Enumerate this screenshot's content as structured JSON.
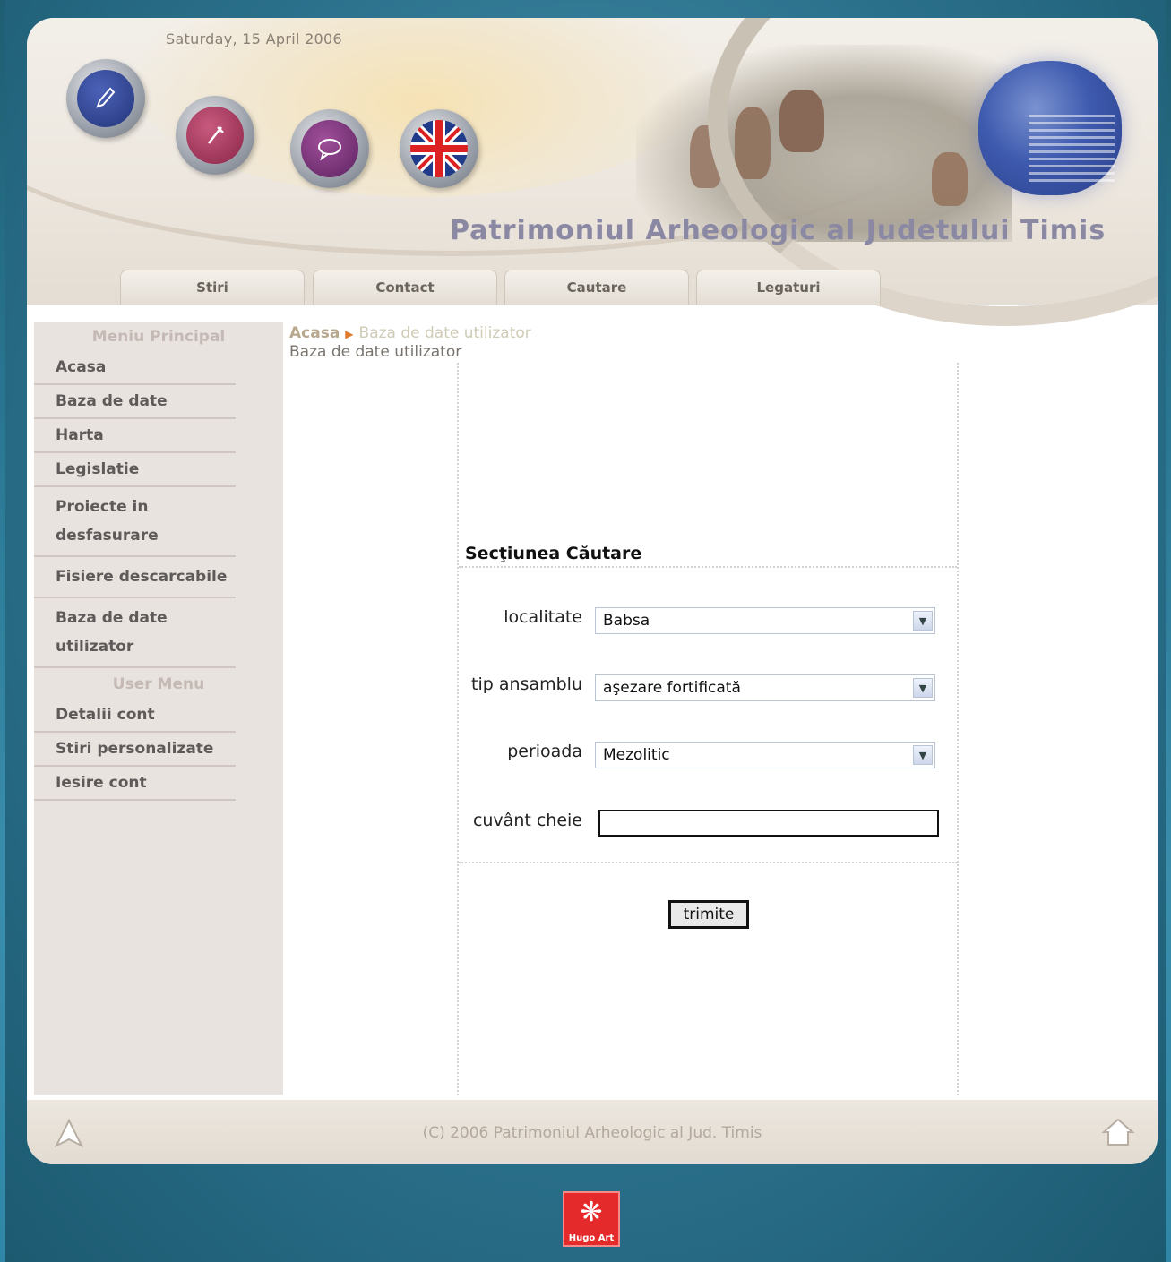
{
  "header": {
    "date": "Saturday, 15 April 2006",
    "site_title": "Patrimoniul Arheologic al Judetului Timis",
    "icons": [
      "pen-icon",
      "tools-icon",
      "chat-icon",
      "uk-flag-icon"
    ]
  },
  "tabs": [
    "Stiri",
    "Contact",
    "Cautare",
    "Legaturi"
  ],
  "sidebar": {
    "main_heading": "Meniu Principal",
    "main_items": [
      {
        "label": "Acasa"
      },
      {
        "label": "Baza de date"
      },
      {
        "label": "Harta"
      },
      {
        "label": "Legislatie"
      },
      {
        "label": "Proiecte in desfasurare"
      },
      {
        "label": "Fisiere descarcabile"
      },
      {
        "label": "Baza de date utilizator"
      }
    ],
    "user_heading": "User Menu",
    "user_items": [
      {
        "label": "Detalii cont"
      },
      {
        "label": "Stiri personalizate"
      },
      {
        "label": "Iesire cont"
      }
    ]
  },
  "breadcrumb": {
    "home": "Acasa",
    "current": "Baza de date utilizator"
  },
  "subtitle": "Baza de date utilizator",
  "form": {
    "section_title": "Secţiunea Căutare",
    "localitate_label": "localitate",
    "localitate_value": "Babsa",
    "tip_label": "tip ansamblu",
    "tip_value": "aşezare fortificată",
    "perioada_label": "perioada",
    "perioada_value": "Mezolitic",
    "cuvant_label": "cuvânt cheie",
    "cuvant_value": "",
    "submit_label": "trimite"
  },
  "footer": {
    "copyright": "(C) 2006 Patrimoniul Arheologic al Jud. Timis"
  },
  "badge": {
    "label": "Hugo Art"
  },
  "colors": {
    "background": "#2b7894",
    "sidebar": "#e9e3df",
    "title": "#8b88a3",
    "badge": "#e52a2c",
    "breadcrumb_arrow": "#e07b2c"
  }
}
